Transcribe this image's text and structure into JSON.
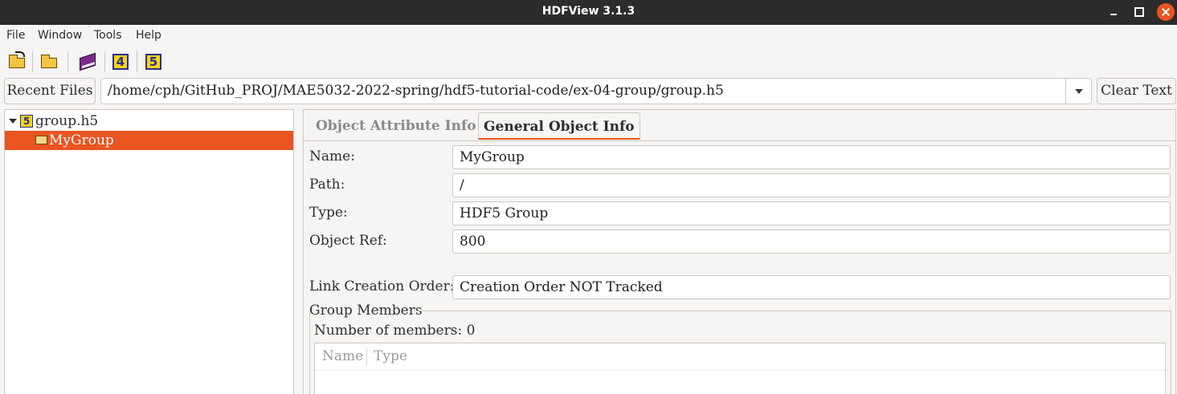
{
  "window": {
    "title": "HDFView 3.1.3"
  },
  "menubar": {
    "items": [
      "File",
      "Window",
      "Tools",
      "Help"
    ]
  },
  "toolbar": {
    "icons": [
      "open-file-icon",
      "open-folder-icon",
      "users-guide-icon",
      "hdf4-library-icon",
      "hdf5-library-icon"
    ],
    "hdf4_glyph": "4",
    "hdf5_glyph": "5"
  },
  "filebar": {
    "recent_label": "Recent Files",
    "path_value": "/home/cph/GitHub_PROJ/MAE5032-2022-spring/hdf5-tutorial-code/ex-04-group/group.h5",
    "clear_label": "Clear Text"
  },
  "tree": {
    "root_label": "group.h5",
    "child_label": "MyGroup",
    "selected_color": "#e95420"
  },
  "tabs": [
    {
      "label": "Object Attribute Info",
      "active": false
    },
    {
      "label": "General Object Info",
      "active": true
    }
  ],
  "info": {
    "name_label": "Name:",
    "name_value": "MyGroup",
    "path_label": "Path:",
    "path_value": "/",
    "type_label": "Type:",
    "type_value": "HDF5 Group",
    "ref_label": "Object Ref:",
    "ref_value": "800",
    "link_order_label": "Link Creation Order:",
    "link_order_value": "Creation Order NOT Tracked"
  },
  "group_members": {
    "title": "Group Members",
    "count_text": "Number of members: 0",
    "columns": [
      "Name",
      "Type"
    ]
  }
}
